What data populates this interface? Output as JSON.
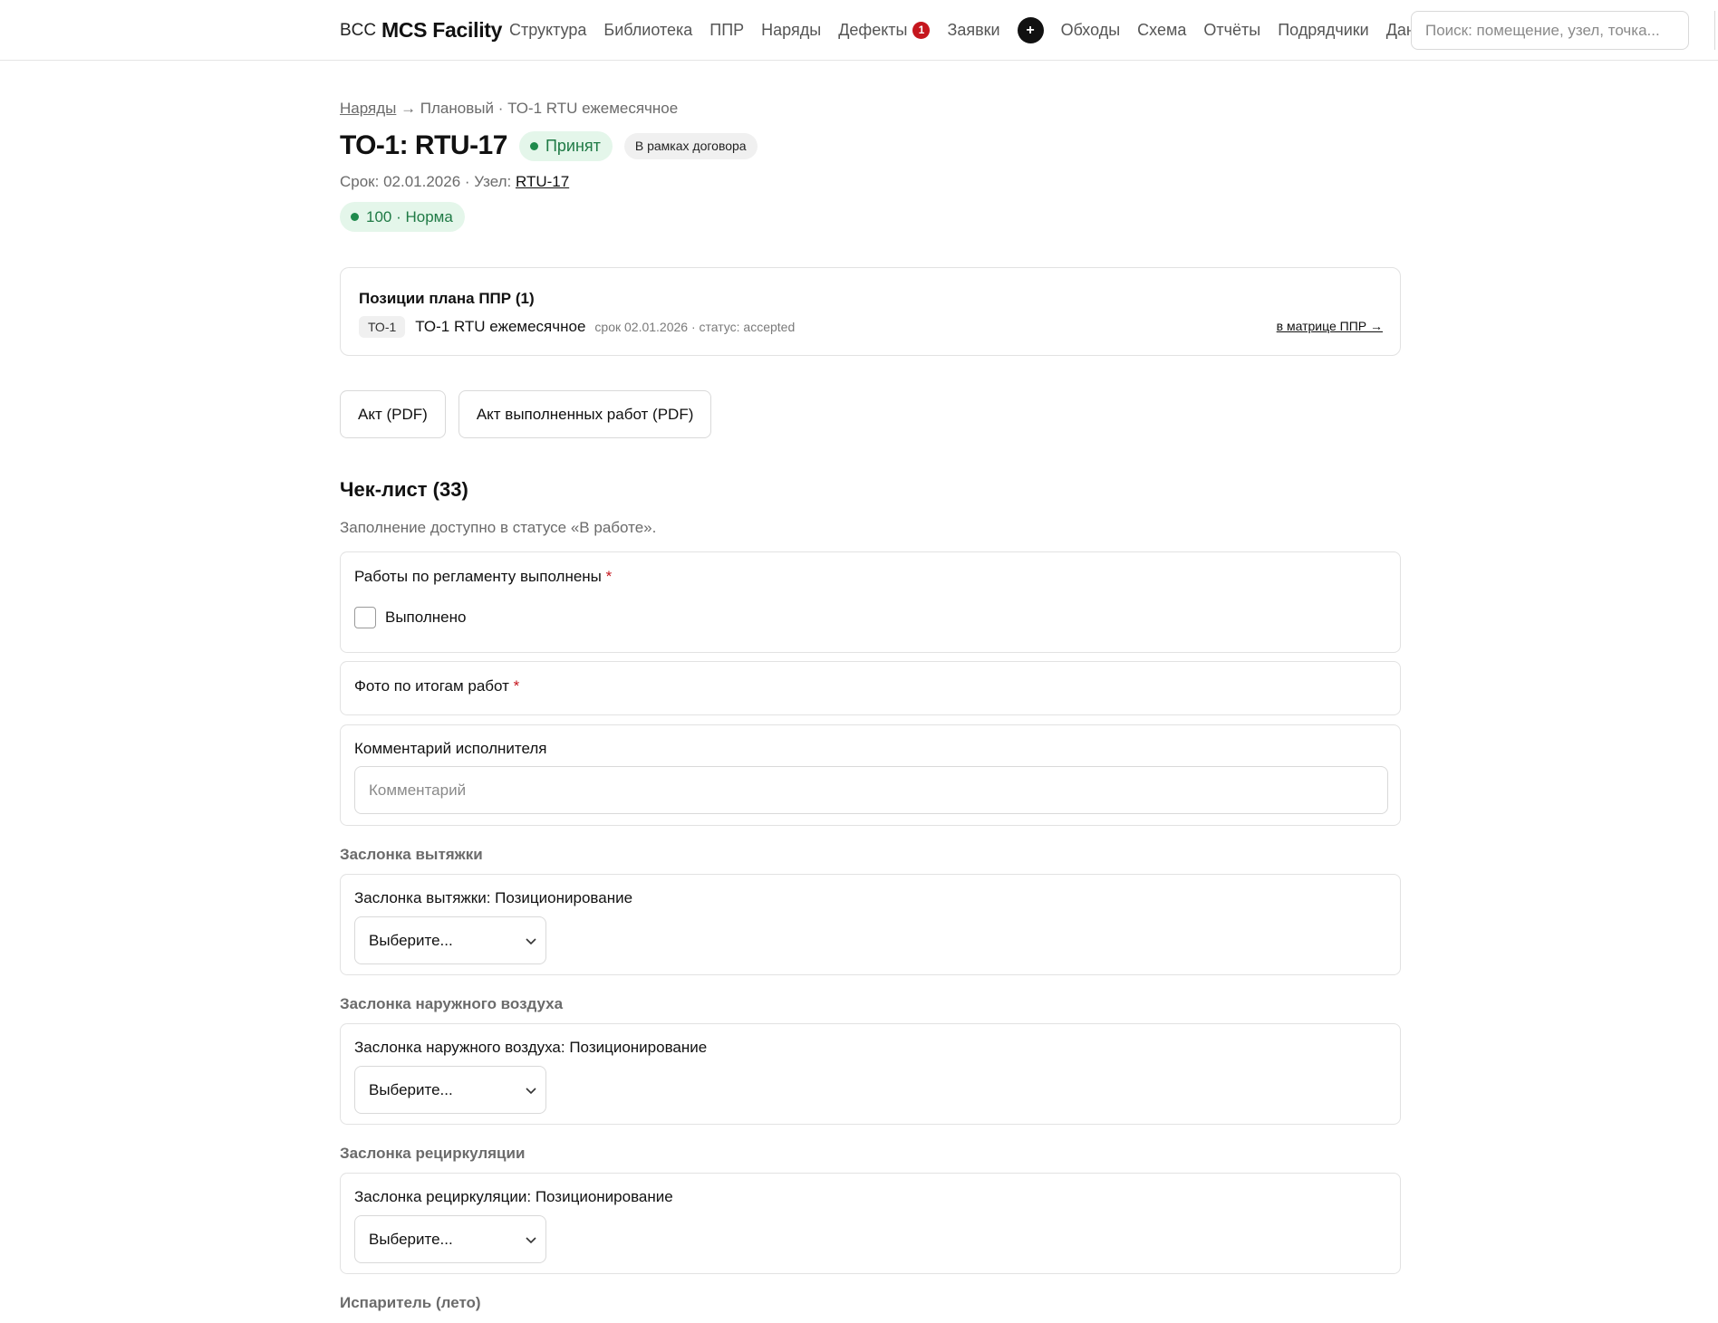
{
  "nav": {
    "brand_prefix": "BCC",
    "brand_name": "MCS Facility",
    "items": [
      "Структура",
      "Библиотека",
      "ППР",
      "Наряды"
    ],
    "defects_label": "Дефекты",
    "defects_badge": "1",
    "requests_label": "Заявки",
    "plus_label": "+",
    "items_after": [
      "Обходы",
      "Схема",
      "Отчёты",
      "Подрядчики",
      "Данные"
    ],
    "search_placeholder": "Поиск: помещение, узел, точка..."
  },
  "header": {
    "breadcrumb_link": "Наряды",
    "breadcrumb_rest": " → Плановый · ТО-1 RTU ежемесячное",
    "title": "ТО-1: RTU-17",
    "status": "Принят",
    "contract_badge": "В рамках договора",
    "meta_prefix": "Срок: 02.01.2026 · Узел: ",
    "meta_node": "RTU-17",
    "score": "100 · Норма"
  },
  "colors": {
    "status_green": "#1f8a4c",
    "status_bg": "#e4f6ea",
    "badge_red": "#c5161d"
  },
  "plan": {
    "title": "Позиции плана ППР (1)",
    "code": "ТО-1",
    "name": "ТО-1 RTU ежемесячное",
    "meta": "срок 02.01.2026 · статус: accepted",
    "link": "в матрице ППР →"
  },
  "acts": {
    "act_pdf": "Акт (PDF)",
    "works_act_pdf": "Акт выполненных работ (PDF)"
  },
  "checklist": {
    "title": "Чек-лист (33)",
    "note": "Заполнение доступно в статусе «В работе».",
    "works_label": "Работы по регламенту выполнены",
    "required_mark": "*",
    "done_label": "Выполнено",
    "photo_label": "Фото по итогам работ",
    "comment_label": "Комментарий исполнителя",
    "comment_placeholder": "Комментарий",
    "groups": [
      {
        "title": "Заслонка вытяжки",
        "field": "Заслонка вытяжки: Позиционирование",
        "select": "Выберите..."
      },
      {
        "title": "Заслонка наружного воздуха",
        "field": "Заслонка наружного воздуха: Позиционирование",
        "select": "Выберите..."
      },
      {
        "title": "Заслонка рециркуляции",
        "field": "Заслонка рециркуляции: Позиционирование",
        "select": "Выберите..."
      },
      {
        "title": "Испаритель (лето)"
      }
    ]
  }
}
